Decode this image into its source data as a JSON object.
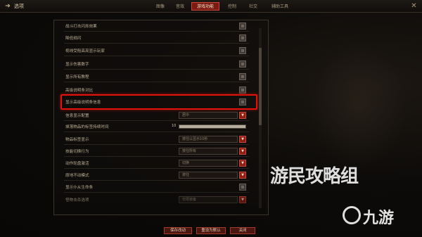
{
  "header": {
    "title": "选项",
    "tabs": [
      {
        "label": "图像",
        "active": false
      },
      {
        "label": "音效",
        "active": false
      },
      {
        "label": "游戏功能",
        "active": true
      },
      {
        "label": "控制",
        "active": false
      },
      {
        "label": "社交",
        "active": false
      },
      {
        "label": "辅助工具",
        "active": false
      }
    ]
  },
  "settings": {
    "checkbox_rows": [
      {
        "label": "战斗打击闪烁效果",
        "checked": false
      },
      {
        "label": "降低频闪",
        "checked": false
      },
      {
        "label": "视线受阻高亮显示玩家",
        "checked": false
      },
      {
        "label": "显示伤害数字",
        "checked": false
      },
      {
        "label": "显示所有教程",
        "checked": false
      },
      {
        "label": "高级说明条对比",
        "checked": false
      },
      {
        "label": "显示高级说明条信息",
        "checked": false
      }
    ],
    "info_display": {
      "label": "信息显示配置",
      "value": "居中"
    },
    "drop_label_duration": {
      "label": "掉落物品的标签持续时间",
      "value": "10",
      "fill": 1.0
    },
    "item_label_display": {
      "label": "物品标签显示",
      "value": "按住以显示10秒"
    },
    "skill_switch": {
      "label": "技能切换行为",
      "value": "按住所有"
    },
    "wheel_activation": {
      "label": "动作轮盘激活",
      "value": "切换"
    },
    "stand_still": {
      "label": "原地不动模式",
      "value": "按住"
    },
    "show_life": {
      "label": "显示仆从生命条",
      "checked": false
    },
    "pet_loot": {
      "label": "怪物击杀选项",
      "value": "仅限装备"
    }
  },
  "footer": {
    "save_label": "保存改动",
    "reset_label": "重设为默认",
    "close_label": "关闭"
  },
  "watermark": {
    "line1": "游民攻略组",
    "line2": "九游"
  },
  "colors": {
    "accent_red": "#8f1c12",
    "highlight_red": "#e3120b",
    "text": "#bdb095"
  }
}
